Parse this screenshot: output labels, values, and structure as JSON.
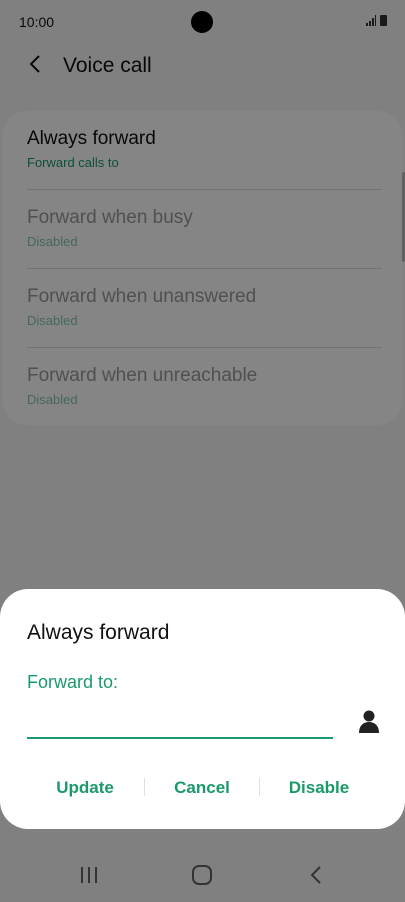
{
  "status_bar": {
    "time": "10:00",
    "icons": [
      "signal-icon",
      "battery-icon"
    ]
  },
  "app_bar": {
    "title": "Voice call",
    "back_icon": "back-arrow-icon"
  },
  "settings": [
    {
      "title": "Always forward",
      "subtitle": "Forward calls to",
      "enabled": true
    },
    {
      "title": "Forward when busy",
      "subtitle": "Disabled",
      "enabled": false
    },
    {
      "title": "Forward when unanswered",
      "subtitle": "Disabled",
      "enabled": false
    },
    {
      "title": "Forward when unreachable",
      "subtitle": "Disabled",
      "enabled": false
    }
  ],
  "dialog": {
    "title": "Always forward",
    "field_label": "Forward to:",
    "field_value": "",
    "contact_icon": "contact-person-icon",
    "buttons": {
      "update": "Update",
      "cancel": "Cancel",
      "disable": "Disable"
    }
  },
  "nav_bar": {
    "icons": [
      "recent-apps-icon",
      "home-icon",
      "back-icon"
    ]
  },
  "colors": {
    "accent": "#1a9a6b",
    "scrim": "rgba(0,0,0,0.48)",
    "dialog_bg": "#ffffff"
  }
}
